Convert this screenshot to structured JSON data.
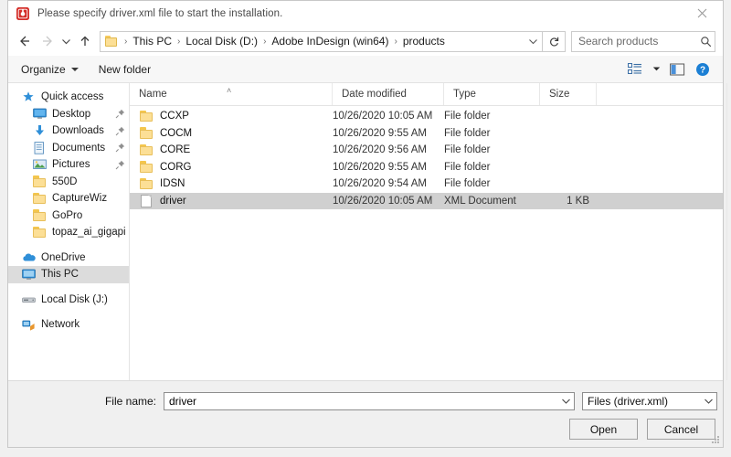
{
  "window": {
    "title": "Please specify driver.xml file to start the installation.",
    "app_icon": "adobe-indesign-icon",
    "close_label": "✕"
  },
  "nav": {
    "back_icon": "arrow-left-icon",
    "forward_icon": "arrow-right-icon",
    "recent_icon": "chevron-down-icon",
    "up_icon": "arrow-up-icon",
    "refresh_icon": "refresh-icon",
    "breadcrumbs": [
      "This PC",
      "Local Disk (D:)",
      "Adobe InDesign (win64)",
      "products"
    ],
    "separator": "›",
    "dropdown_icon": "chevron-down-icon"
  },
  "search": {
    "placeholder": "Search products",
    "value": "",
    "icon": "search-icon"
  },
  "toolbar": {
    "organize_label": "Organize",
    "new_folder_label": "New folder",
    "view_icon": "view-options-icon",
    "view_caret_icon": "chevron-down-icon",
    "preview_pane_icon": "preview-pane-icon",
    "help_icon": "help-icon"
  },
  "sidebar": {
    "items": [
      {
        "label": "Quick access",
        "icon": "star-icon",
        "indent": false,
        "pinned": false,
        "selected": false
      },
      {
        "label": "Desktop",
        "icon": "desktop-icon",
        "indent": true,
        "pinned": true,
        "selected": false
      },
      {
        "label": "Downloads",
        "icon": "downloads-icon",
        "indent": true,
        "pinned": true,
        "selected": false
      },
      {
        "label": "Documents",
        "icon": "documents-icon",
        "indent": true,
        "pinned": true,
        "selected": false
      },
      {
        "label": "Pictures",
        "icon": "pictures-icon",
        "indent": true,
        "pinned": true,
        "selected": false
      },
      {
        "label": "550D",
        "icon": "folder-icon",
        "indent": true,
        "pinned": false,
        "selected": false
      },
      {
        "label": "CaptureWiz",
        "icon": "folder-icon",
        "indent": true,
        "pinned": false,
        "selected": false
      },
      {
        "label": "GoPro",
        "icon": "folder-icon",
        "indent": true,
        "pinned": false,
        "selected": false
      },
      {
        "label": "topaz_ai_gigapixel_",
        "icon": "folder-icon",
        "indent": true,
        "pinned": false,
        "selected": false
      },
      {
        "label": "OneDrive",
        "icon": "onedrive-icon",
        "indent": false,
        "pinned": false,
        "selected": false,
        "gap_before": true
      },
      {
        "label": "This PC",
        "icon": "thispc-icon",
        "indent": false,
        "pinned": false,
        "selected": true
      },
      {
        "label": "Local Disk (J:)",
        "icon": "drive-icon",
        "indent": false,
        "pinned": false,
        "selected": false,
        "gap_before": true
      },
      {
        "label": "Network",
        "icon": "network-icon",
        "indent": false,
        "pinned": false,
        "selected": false,
        "gap_before": true
      }
    ]
  },
  "filelist": {
    "columns": [
      "Name",
      "Date modified",
      "Type",
      "Size"
    ],
    "sort_column": "Name",
    "sort_caret": "˄",
    "rows": [
      {
        "name": "CCXP",
        "date": "10/26/2020 10:05 AM",
        "type": "File folder",
        "size": "",
        "icon": "folder-icon",
        "selected": false
      },
      {
        "name": "COCM",
        "date": "10/26/2020 9:55 AM",
        "type": "File folder",
        "size": "",
        "icon": "folder-icon",
        "selected": false
      },
      {
        "name": "CORE",
        "date": "10/26/2020 9:56 AM",
        "type": "File folder",
        "size": "",
        "icon": "folder-icon",
        "selected": false
      },
      {
        "name": "CORG",
        "date": "10/26/2020 9:55 AM",
        "type": "File folder",
        "size": "",
        "icon": "folder-icon",
        "selected": false
      },
      {
        "name": "IDSN",
        "date": "10/26/2020 9:54 AM",
        "type": "File folder",
        "size": "",
        "icon": "folder-icon",
        "selected": false
      },
      {
        "name": "driver",
        "date": "10/26/2020 10:05 AM",
        "type": "XML Document",
        "size": "1 KB",
        "icon": "xml-document-icon",
        "selected": true
      }
    ]
  },
  "footer": {
    "filename_label": "File name:",
    "filename_value": "driver",
    "filetype_value": "Files (driver.xml)",
    "open_label": "Open",
    "cancel_label": "Cancel"
  },
  "colors": {
    "accent_blue": "#0078d7",
    "adobe_red": "#d42f2a",
    "folder_yellow": "#fcdf96",
    "selection_gray": "#d0d0d0"
  }
}
